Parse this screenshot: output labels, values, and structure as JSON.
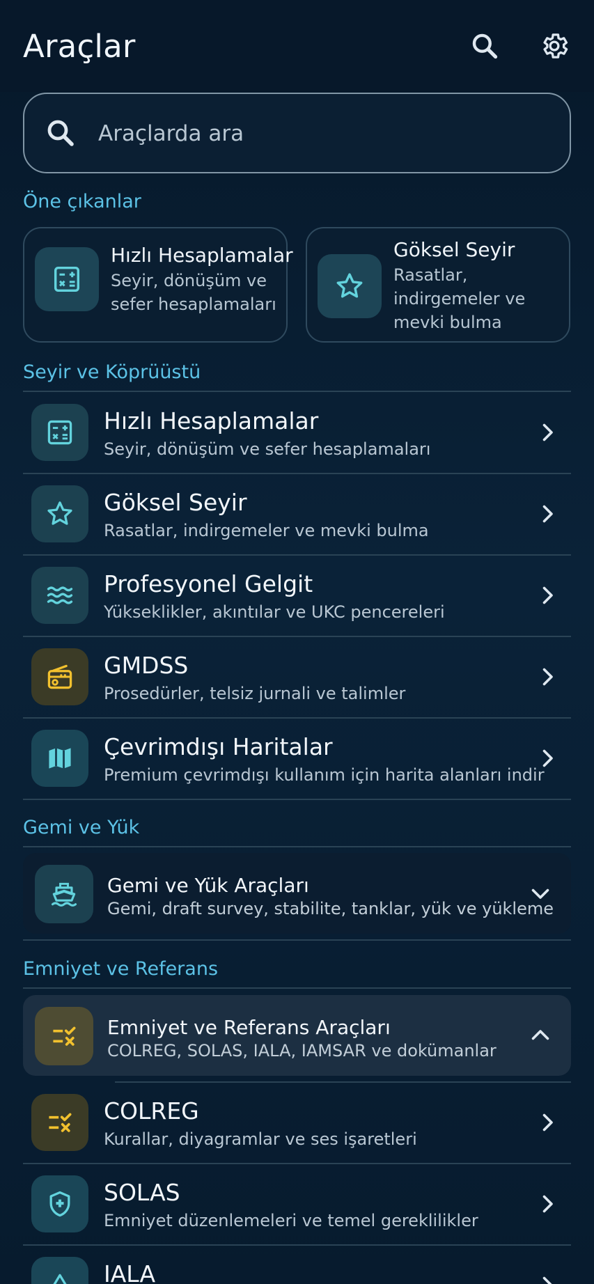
{
  "header": {
    "title": "Araçlar",
    "search_icon": "search-icon",
    "settings_icon": "gear-icon"
  },
  "search": {
    "placeholder": "Araçlarda ara"
  },
  "featured": {
    "label": "Öne çıkanlar",
    "cards": [
      {
        "title": "Hızlı Hesaplamalar",
        "subtitle": "Seyir, dönüşüm ve\nsefer hesaplamaları",
        "icon": "calculator-icon"
      },
      {
        "title": "Göksel Seyir",
        "subtitle": "Rasatlar,\nindirgemeler ve\nmevki bulma",
        "icon": "star-icon"
      }
    ]
  },
  "navigation": {
    "label": "Seyir ve Köprüüstü",
    "items": [
      {
        "title": "Hızlı Hesaplamalar",
        "subtitle": "Seyir, dönüşüm ve sefer hesaplamaları",
        "icon": "calculator-icon"
      },
      {
        "title": "Göksel Seyir",
        "subtitle": "Rasatlar, indirgemeler ve mevki bulma",
        "icon": "star-icon"
      },
      {
        "title": "Profesyonel Gelgit",
        "subtitle": "Yükseklikler, akıntılar ve UKC pencereleri",
        "icon": "waves-icon"
      },
      {
        "title": "GMDSS",
        "subtitle": "Prosedürler, telsiz jurnali ve talimler",
        "icon": "radio-icon"
      },
      {
        "title": "Çevrimdışı Haritalar",
        "subtitle": "Premium çevrimdışı kullanım için harita alanları indir",
        "icon": "map-icon"
      }
    ]
  },
  "ship": {
    "label": "Gemi ve Yük",
    "group": {
      "title": "Gemi ve Yük Araçları",
      "subtitle": "Gemi, draft survey, stabilite, tanklar, yük ve yükleme",
      "icon": "ship-icon",
      "state": "collapsed"
    }
  },
  "safety": {
    "label": "Emniyet ve Referans",
    "group": {
      "title": "Emniyet ve Referans Araçları",
      "subtitle": "COLREG, SOLAS, IALA, IAMSAR ve dokümanlar",
      "icon": "checklist-icon",
      "state": "expanded"
    },
    "items": [
      {
        "title": "COLREG",
        "subtitle": "Kurallar, diyagramlar ve ses işaretleri",
        "icon": "checklist-icon"
      },
      {
        "title": "SOLAS",
        "subtitle": "Emniyet düzenlemeleri ve temel gereklilikler",
        "icon": "shield-icon"
      },
      {
        "title": "IALA",
        "subtitle": "",
        "icon": "buoy-icon"
      }
    ]
  },
  "colors": {
    "background": "#071a2d",
    "accent": "#5cc2e6",
    "teal_icon": "#63d3dd",
    "amber_icon": "#f2c12e"
  }
}
